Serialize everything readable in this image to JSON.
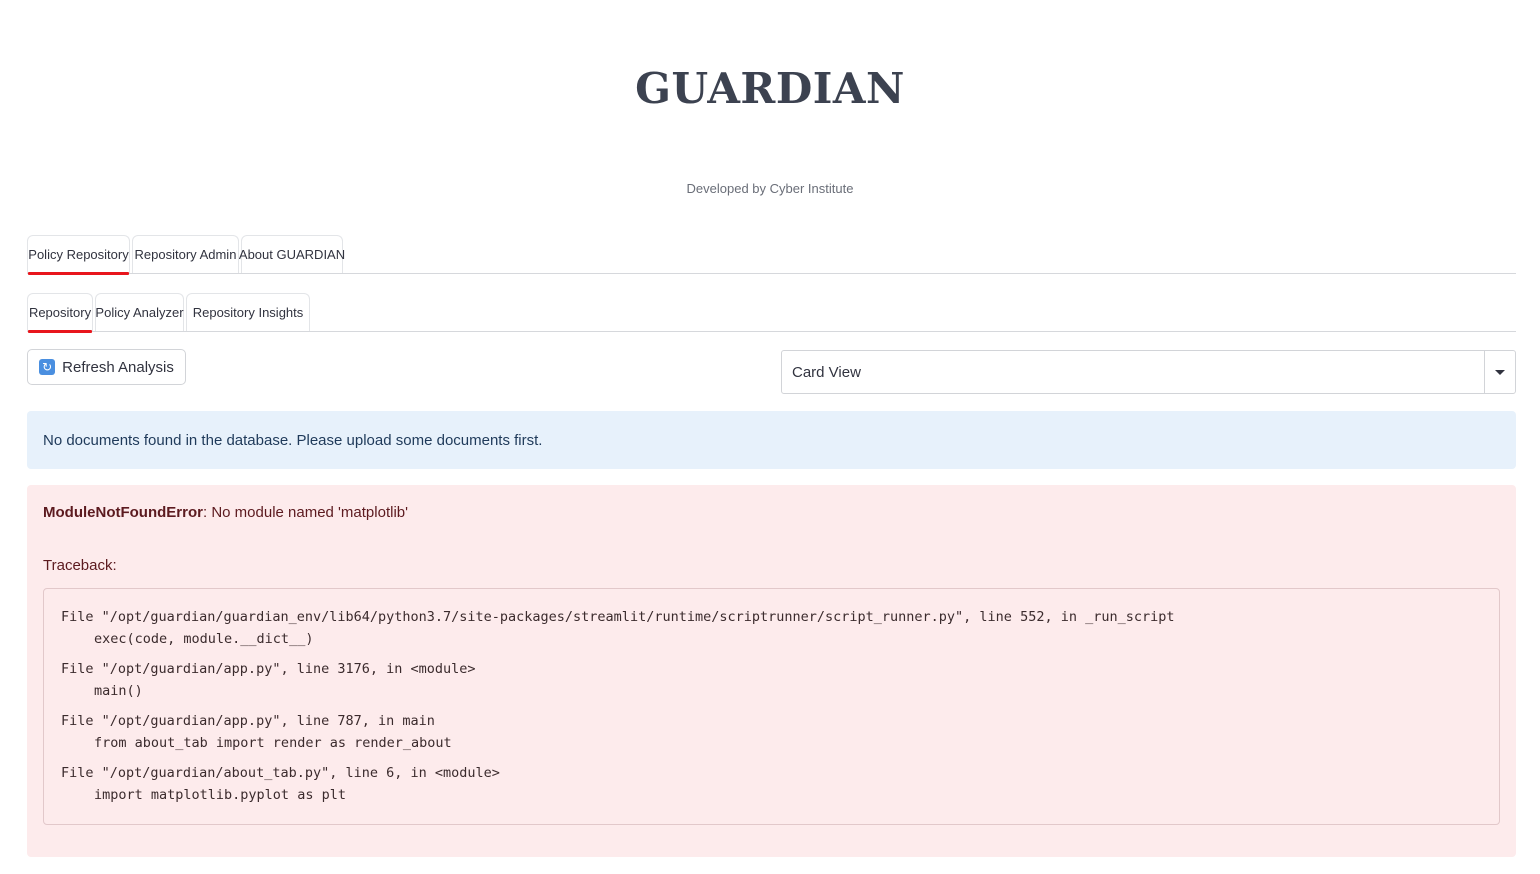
{
  "app": {
    "title": "GUARDIAN",
    "subtitle": "Developed by Cyber Institute"
  },
  "main_tabs": [
    {
      "label": "Policy Repository",
      "active": true
    },
    {
      "label": "Repository Admin",
      "active": false
    },
    {
      "label": "About GUARDIAN",
      "active": false
    }
  ],
  "sub_tabs": [
    {
      "label": "Repository",
      "active": true
    },
    {
      "label": "Policy Analyzer",
      "active": false
    },
    {
      "label": "Repository Insights",
      "active": false
    }
  ],
  "toolbar": {
    "refresh_icon": "refresh-icon",
    "refresh_label": "Refresh Analysis",
    "view_select_value": "Card View"
  },
  "info": {
    "message": "No documents found in the database. Please upload some documents first."
  },
  "error": {
    "type": "ModuleNotFoundError",
    "message": " No module named 'matplotlib'",
    "traceback_label": "Traceback:",
    "frames": [
      {
        "location": "File \"/opt/guardian/guardian_env/lib64/python3.7/site-packages/streamlit/runtime/scriptrunner/script_runner.py\", line 552, in _run_script",
        "code": "exec(code, module.__dict__)"
      },
      {
        "location": "File \"/opt/guardian/app.py\", line 3176, in <module>",
        "code": "main()"
      },
      {
        "location": "File \"/opt/guardian/app.py\", line 787, in main",
        "code": "from about_tab import render as render_about"
      },
      {
        "location": "File \"/opt/guardian/about_tab.py\", line 6, in <module>",
        "code": "import matplotlib.pyplot as plt"
      }
    ]
  },
  "colors": {
    "active_tab_underline": "#e8161d",
    "info_background": "#e7f1fb",
    "error_background": "#fdebec"
  }
}
